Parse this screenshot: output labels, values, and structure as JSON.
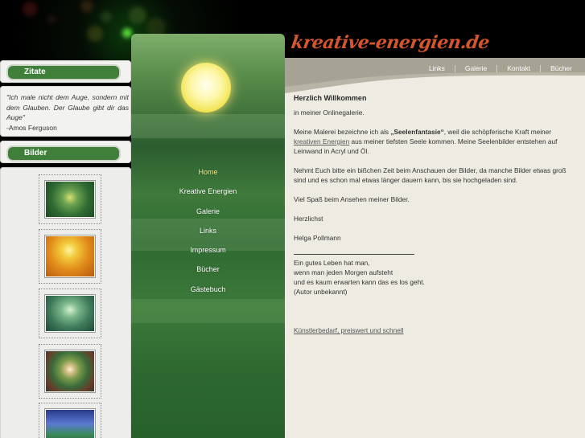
{
  "logo": "kreative-energien.de",
  "top_nav": [
    "Links",
    "Galerie",
    "Kontakt",
    "Bücher"
  ],
  "sidebar": {
    "quotes_title": "Zitate",
    "quote_text": "\"Ich male nicht dem Auge, sondern mit dem Glauben. Der Glaube gibt dir das Auge\"",
    "quote_author": "-Amos Ferguson",
    "images_title": "Bilder"
  },
  "menu": [
    "Home",
    "Kreative Energien",
    "Galerie",
    "Links",
    "Impressum",
    "Bücher",
    "Gästebuch"
  ],
  "content": {
    "title": "Herzlich Willkommen",
    "intro": "in meiner Onlinegalerie.",
    "p1_a": "Meine Malerei bezeichne ich als ",
    "p1_bold": "„Seelenfantasie“",
    "p1_b": ", weil die schöpferische Kraft meiner ",
    "p1_link": "kreativen Energien",
    "p1_c": " aus meiner tiefsten Seele kommen. Meine Seelenbilder entstehen auf Leinwand in Acryl und Öl.",
    "p2": "Nehmt Euch bitte ein bißchen Zeit beim Anschauen der Bilder, da manche Bilder etwas groß sind und es schon mal etwas länger dauern kann, bis sie hochgeladen sind.",
    "p3": "Viel Spaß beim Ansehen meiner Bilder.",
    "p4": "Herzlichst",
    "signature": "Helga Pollmann",
    "poem": [
      "Ein gutes Leben hat man,",
      "wenn man jeden Morgen aufsteht",
      "und es kaum erwarten kann das es los geht.",
      "(Autor unbekannt)"
    ],
    "footer_link": "Künstlerbedarf, preiswert und schnell"
  },
  "colors": {
    "accent_green": "#3f7f3a",
    "logo": "#d4562e",
    "content_bg": "#eeebe2"
  }
}
